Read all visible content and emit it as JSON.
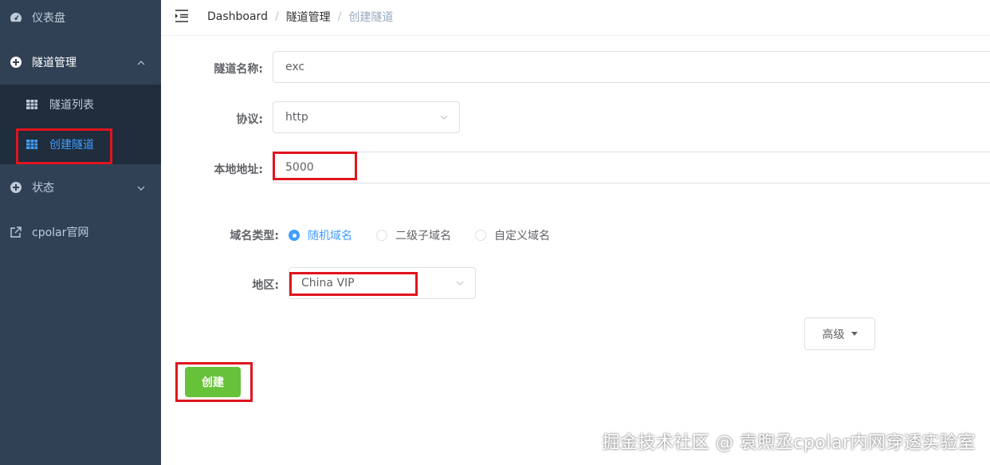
{
  "sidebar": {
    "dashboard": "仪表盘",
    "tunnel_mgmt": "隧道管理",
    "tunnel_list": "隧道列表",
    "create_tunnel": "创建隧道",
    "status": "状态",
    "cpolar_site": "cpolar官网"
  },
  "breadcrumb": [
    "Dashboard",
    "隧道管理",
    "创建隧道"
  ],
  "form": {
    "name_label": "隧道名称:",
    "name_value": "exc",
    "protocol_label": "协议:",
    "protocol_value": "http",
    "local_addr_label": "本地地址:",
    "local_addr_value": "5000",
    "domain_type_label": "域名类型:",
    "domain_options": [
      "随机域名",
      "二级子域名",
      "自定义域名"
    ],
    "domain_selected": "随机域名",
    "region_label": "地区:",
    "region_value": "China VIP",
    "advanced_label": "高级",
    "create_label": "创建"
  },
  "watermark": "掘金技术社区 @ 袁煦丞cpolar内网穿透实验室",
  "colors": {
    "sidebar_bg": "#304156",
    "submenu_bg": "#1f2d3d",
    "accent": "#409eff",
    "create_button": "#67c23a",
    "highlight_box": "#e0141e"
  }
}
